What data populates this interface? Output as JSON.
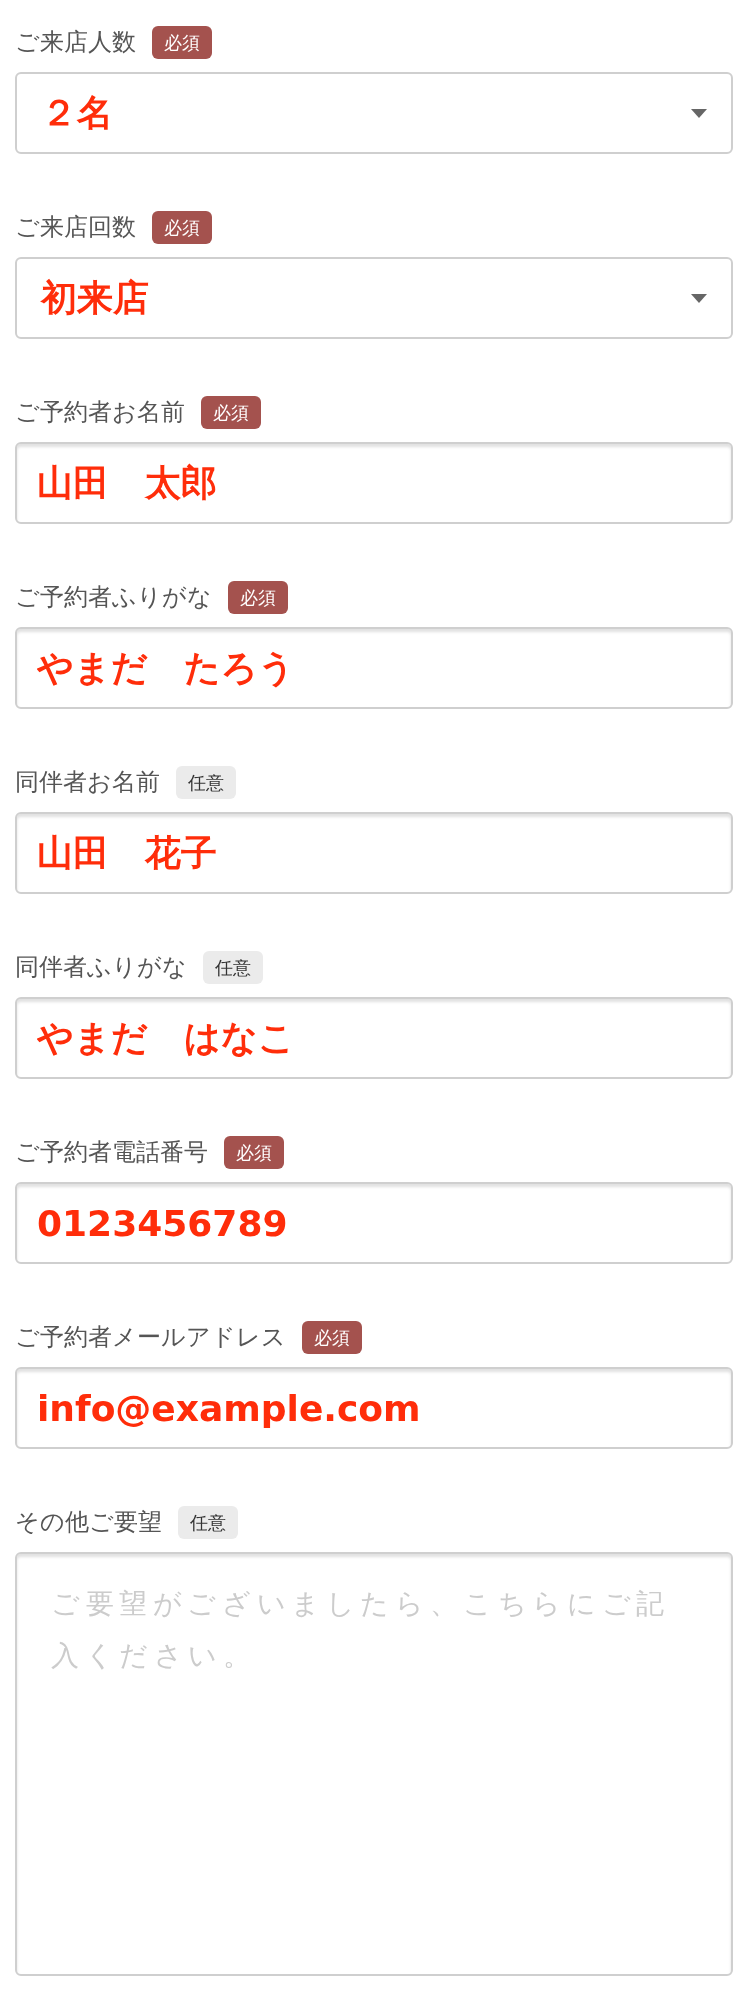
{
  "fields": [
    {
      "kind": "select",
      "label": "ご来店人数",
      "badge": {
        "text": "必須",
        "required": true
      },
      "value": "２名"
    },
    {
      "kind": "select",
      "label": "ご来店回数",
      "badge": {
        "text": "必須",
        "required": true
      },
      "value": "初来店"
    },
    {
      "kind": "text",
      "label": "ご予約者お名前",
      "badge": {
        "text": "必須",
        "required": true
      },
      "value": "山田　太郎"
    },
    {
      "kind": "text",
      "label": "ご予約者ふりがな",
      "badge": {
        "text": "必須",
        "required": true
      },
      "value": "やまだ　たろう"
    },
    {
      "kind": "text",
      "label": "同伴者お名前",
      "badge": {
        "text": "任意",
        "required": false
      },
      "value": "山田　花子"
    },
    {
      "kind": "text",
      "label": "同伴者ふりがな",
      "badge": {
        "text": "任意",
        "required": false
      },
      "value": "やまだ　はなこ"
    },
    {
      "kind": "text",
      "label": "ご予約者電話番号",
      "badge": {
        "text": "必須",
        "required": true
      },
      "value": "0123456789"
    },
    {
      "kind": "text",
      "label": "ご予約者メールアドレス",
      "badge": {
        "text": "必須",
        "required": true
      },
      "value": "info@example.com"
    },
    {
      "kind": "textarea",
      "label": "その他ご要望",
      "badge": {
        "text": "任意",
        "required": false
      },
      "placeholder": "ご要望がございましたら、こちらにご記入ください。"
    }
  ]
}
